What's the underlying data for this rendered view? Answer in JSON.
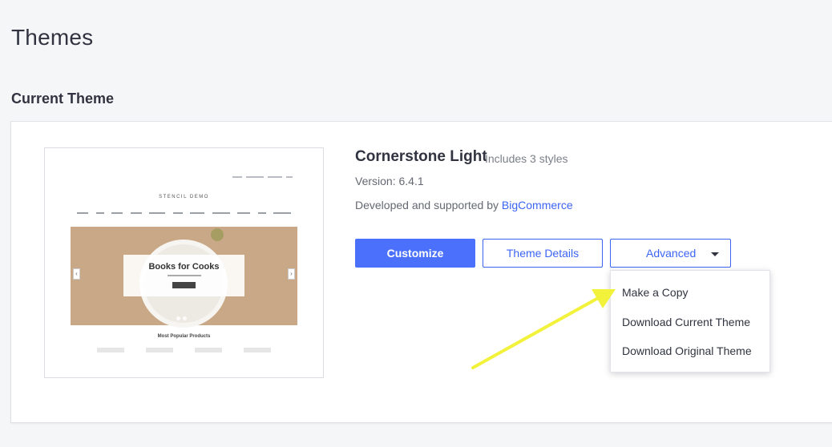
{
  "page": {
    "title": "Themes"
  },
  "current_theme": {
    "section_title": "Current Theme",
    "name": "Cornerstone Light",
    "styles_note": "Includes 3 styles",
    "version": "Version: 6.4.1",
    "developer_prefix": "Developed and supported by ",
    "developer_name": "BigCommerce",
    "thumbnail": {
      "brand": "STENCIL DEMO",
      "hero_title": "Books for Cooks",
      "section_heading": "Most Popular Products"
    }
  },
  "actions": {
    "customize_label": "Customize",
    "details_label": "Theme Details",
    "advanced_label": "Advanced"
  },
  "advanced_menu": {
    "items": [
      "Make a Copy",
      "Download Current Theme",
      "Download Original Theme"
    ]
  },
  "colors": {
    "accent": "#3c64f4",
    "primary_button": "#4b71fc",
    "annotation_arrow": "#f2f23a"
  }
}
